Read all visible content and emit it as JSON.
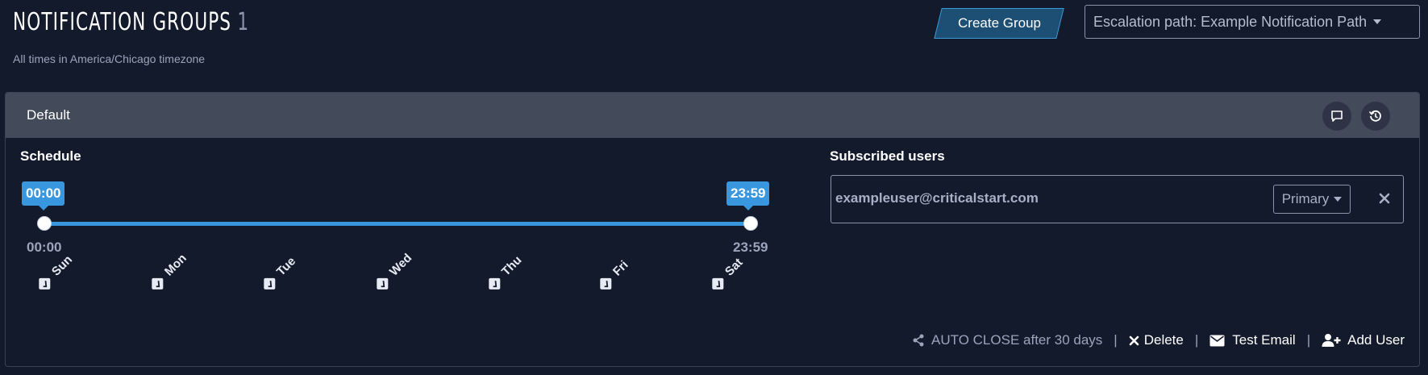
{
  "header": {
    "title": "NOTIFICATION GROUPS",
    "count": "1",
    "timezone_note": "All times in America/Chicago timezone",
    "create_group_label": "Create Group",
    "escalation_select_value": "Escalation path: Example Notification Path"
  },
  "group": {
    "name": "Default",
    "header_icons": [
      "comment-icon",
      "history-icon"
    ],
    "schedule": {
      "label": "Schedule",
      "start": "00:00",
      "end": "23:59",
      "start_label": "00:00",
      "end_label": "23:59",
      "days": [
        {
          "label": "Sun",
          "checked": true
        },
        {
          "label": "Mon",
          "checked": true
        },
        {
          "label": "Tue",
          "checked": true
        },
        {
          "label": "Wed",
          "checked": true
        },
        {
          "label": "Thu",
          "checked": true
        },
        {
          "label": "Fri",
          "checked": true
        },
        {
          "label": "Sat",
          "checked": true
        }
      ]
    },
    "subscribed": {
      "label": "Subscribed users",
      "users": [
        {
          "email": "exampleuser@criticalstart.com",
          "role": "Primary"
        }
      ]
    },
    "footer": {
      "auto_close": "AUTO CLOSE after 30 days",
      "delete_label": "Delete",
      "test_email_label": "Test Email",
      "add_user_label": "Add User",
      "separator": "|"
    }
  },
  "colors": {
    "background": "#131a2b",
    "card_header": "#434a5a",
    "accent": "#3897df",
    "muted_text": "#9ba4bc"
  }
}
